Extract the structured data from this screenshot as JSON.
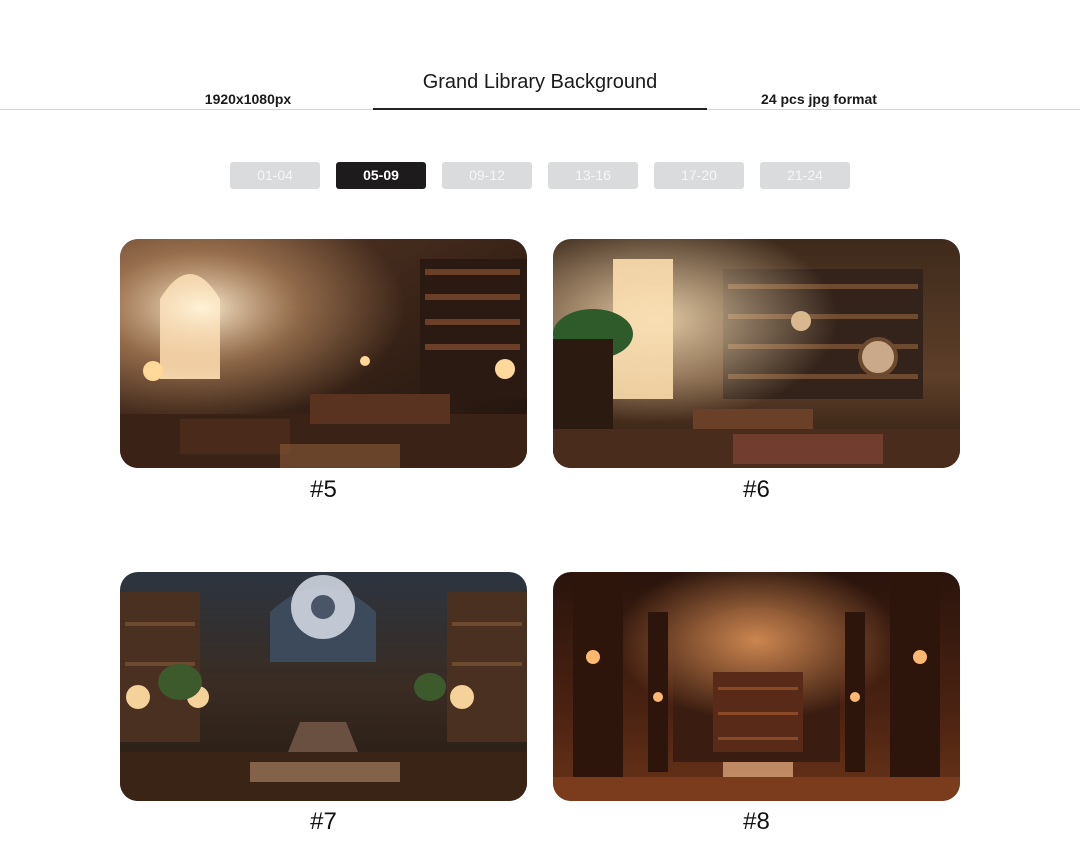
{
  "header": {
    "title": "Grand Library Background",
    "resolution": "1920x1080px",
    "count_format": "24 pcs jpg format"
  },
  "tabs": [
    {
      "label": "01-04",
      "active": false
    },
    {
      "label": "05-09",
      "active": true
    },
    {
      "label": "09-12",
      "active": false
    },
    {
      "label": "13-16",
      "active": false
    },
    {
      "label": "17-20",
      "active": false
    },
    {
      "label": "21-24",
      "active": false
    }
  ],
  "gallery": [
    {
      "label": "#5"
    },
    {
      "label": "#6"
    },
    {
      "label": "#7"
    },
    {
      "label": "#8"
    }
  ]
}
